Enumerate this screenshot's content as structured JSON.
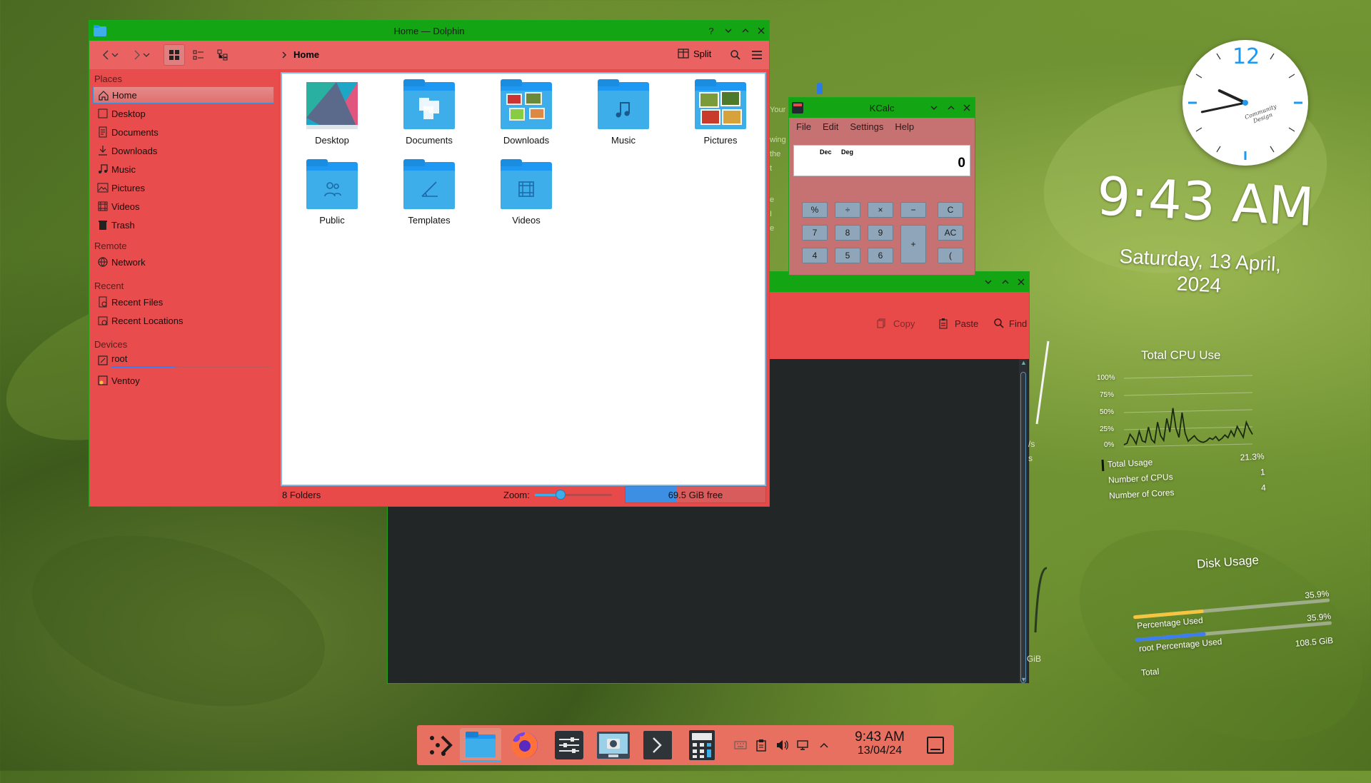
{
  "colors": {
    "titlebar": "#13a513",
    "dolphin_bg": "#e84a4a",
    "accent": "#3daee9",
    "calc_bg": "#c67272",
    "konsole_bg": "#232627",
    "taskbar": "#e87060"
  },
  "dolphin": {
    "title": "Home — Dolphin",
    "toolbar": {
      "location": "Home",
      "split_label": "Split"
    },
    "places_heading": "Places",
    "places": [
      {
        "label": "Home",
        "icon": "home-icon"
      },
      {
        "label": "Desktop",
        "icon": "desktop-icon"
      },
      {
        "label": "Documents",
        "icon": "documents-icon"
      },
      {
        "label": "Downloads",
        "icon": "downloads-icon"
      },
      {
        "label": "Music",
        "icon": "music-icon"
      },
      {
        "label": "Pictures",
        "icon": "pictures-icon"
      },
      {
        "label": "Videos",
        "icon": "videos-icon"
      },
      {
        "label": "Trash",
        "icon": "trash-icon"
      }
    ],
    "remote_heading": "Remote",
    "remote": [
      {
        "label": "Network",
        "icon": "network-icon"
      }
    ],
    "recent_heading": "Recent",
    "recent": [
      {
        "label": "Recent Files",
        "icon": "recent-files-icon"
      },
      {
        "label": "Recent Locations",
        "icon": "recent-locations-icon"
      }
    ],
    "devices_heading": "Devices",
    "devices": [
      {
        "label": "root",
        "icon": "drive-icon",
        "usage_fraction": 0.4
      },
      {
        "label": "Ventoy",
        "icon": "usb-drive-icon"
      }
    ],
    "folders": [
      "Desktop",
      "Documents",
      "Downloads",
      "Music",
      "Pictures",
      "Public",
      "Templates",
      "Videos"
    ],
    "status": {
      "count": "8 Folders",
      "zoom_label": "Zoom:",
      "free": "69.5 GiB free",
      "zoom_fraction": 0.33,
      "disk_used_fraction": 0.36
    }
  },
  "kcalc": {
    "title": "KCalc",
    "menu": [
      "File",
      "Edit",
      "Settings",
      "Help"
    ],
    "indicators": [
      "Dec",
      "Deg"
    ],
    "display": "0",
    "buttons": [
      "%",
      "÷",
      "×",
      "−",
      "C",
      "7",
      "8",
      "9",
      "+",
      "AC",
      "4",
      "5",
      "6",
      "("
    ]
  },
  "konsole": {
    "copy": "Copy",
    "paste": "Paste",
    "find": "Find",
    "fragments": [
      "Your",
      "wing",
      "the",
      "t",
      "e",
      "I",
      "e",
      "/s",
      "s",
      "GiB"
    ]
  },
  "clock": {
    "twelve": "12",
    "brand": "Community Design",
    "hour_deg": 295,
    "minute_deg": 258
  },
  "time": {
    "big": "9:43 AM",
    "date": "Saturday, 13 April, 2024"
  },
  "cpu": {
    "title": "Total CPU Use",
    "ticks": [
      "100%",
      "75%",
      "50%",
      "25%",
      "0%"
    ],
    "rows": [
      {
        "label": "Total Usage",
        "value": "21.3%"
      },
      {
        "label": "Number of CPUs",
        "value": "1"
      },
      {
        "label": "Number of Cores",
        "value": "4"
      }
    ],
    "chart_data": {
      "type": "line",
      "ylim": [
        0,
        100
      ],
      "values": [
        3,
        5,
        18,
        12,
        4,
        22,
        8,
        6,
        28,
        10,
        5,
        35,
        15,
        8,
        40,
        20,
        55,
        25,
        12,
        48,
        18,
        6,
        10,
        14,
        8,
        5,
        4,
        6,
        10,
        8,
        12,
        6,
        9,
        14,
        10,
        20,
        12,
        26,
        18,
        10,
        32,
        22,
        14
      ]
    }
  },
  "disk": {
    "title": "Disk Usage",
    "rows": [
      {
        "label": "Percentage Used",
        "value": "35.9%",
        "fraction": 0.359,
        "color": "#f5c542"
      },
      {
        "label": "root Percentage Used",
        "value": "35.9%",
        "fraction": 0.359,
        "color": "#3d7df0"
      },
      {
        "label": "Total",
        "value": "108.5 GiB"
      }
    ]
  },
  "taskbar": {
    "time": "9:43 AM",
    "date": "13/04/24",
    "apps": [
      "kde-menu-icon",
      "dolphin-icon",
      "firefox-icon",
      "settings-icon",
      "screenshot-icon",
      "konsole-icon",
      "kcalc-icon"
    ]
  }
}
